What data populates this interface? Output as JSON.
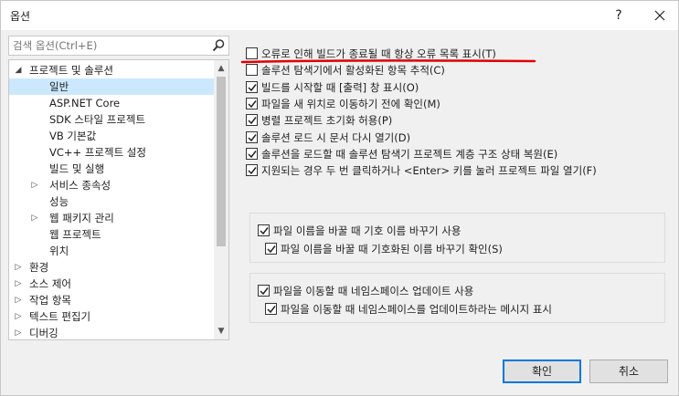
{
  "window": {
    "title": "옵션",
    "help": "?"
  },
  "search": {
    "placeholder": "검색 옵션(Ctrl+E)"
  },
  "tree": [
    {
      "label": "프로젝트 및 솔루션",
      "arrow": "◢",
      "level": 0
    },
    {
      "label": "일반",
      "arrow": "",
      "level": 1,
      "selected": true
    },
    {
      "label": "ASP.NET Core",
      "arrow": "",
      "level": 1
    },
    {
      "label": "SDK 스타일 프로젝트",
      "arrow": "",
      "level": 1
    },
    {
      "label": "VB 기본값",
      "arrow": "",
      "level": 1
    },
    {
      "label": "VC++ 프로젝트 설정",
      "arrow": "",
      "level": 1
    },
    {
      "label": "빌드 및 실행",
      "arrow": "",
      "level": 1
    },
    {
      "label": "서비스 종속성",
      "arrow": "▷",
      "level": 1
    },
    {
      "label": "성능",
      "arrow": "",
      "level": 1
    },
    {
      "label": "웹 패키지 관리",
      "arrow": "▷",
      "level": 1
    },
    {
      "label": "웹 프로젝트",
      "arrow": "",
      "level": 1
    },
    {
      "label": "위치",
      "arrow": "",
      "level": 1
    },
    {
      "label": "환경",
      "arrow": "▷",
      "level": 0
    },
    {
      "label": "소스 제어",
      "arrow": "▷",
      "level": 0
    },
    {
      "label": "작업 항목",
      "arrow": "▷",
      "level": 0
    },
    {
      "label": "텍스트 편집기",
      "arrow": "▷",
      "level": 0
    },
    {
      "label": "디버깅",
      "arrow": "▷",
      "level": 0
    }
  ],
  "options": [
    {
      "label": "오류로 인해 빌드가 종료될 때 항상 오류 목록 표시(T)",
      "checked": false
    },
    {
      "label": "솔루션 탐색기에서 활성화된 항목 추적(C)",
      "checked": false
    },
    {
      "label": "빌드를 시작할 때 [출력] 창 표시(O)",
      "checked": true
    },
    {
      "label": "파일을 새 위치로 이동하기 전에 확인(M)",
      "checked": true
    },
    {
      "label": "병렬 프로젝트 초기화 허용(P)",
      "checked": true
    },
    {
      "label": "솔루션 로드 시 문서 다시 열기(D)",
      "checked": true
    },
    {
      "label": "솔루션을 로드할 때 솔루션 탐색기 프로젝트 계층 구조 상태 복원(E)",
      "checked": true
    },
    {
      "label": "지원되는 경우 두 번 클릭하거나 <Enter> 키를 눌러 프로젝트 파일 열기(F)",
      "checked": true
    }
  ],
  "group1": {
    "main": {
      "label": "파일 이름을 바꿀 때 기호 이름 바꾸기 사용",
      "checked": true
    },
    "sub": {
      "label": "파일 이름을 바꿀 때 기호화된 이름 바꾸기 확인(S)",
      "checked": true
    }
  },
  "group2": {
    "main": {
      "label": "파일을 이동할 때 네임스페이스 업데이트 사용",
      "checked": true
    },
    "sub": {
      "label": "파일을 이동할 때 네임스페이스를 업데이트하라는 메시지 표시",
      "checked": true
    }
  },
  "buttons": {
    "ok": "확인",
    "cancel": "취소"
  },
  "colors": {
    "annotation": "#e00000",
    "selection": "#cce8ff",
    "primary_border": "#0078d7"
  }
}
